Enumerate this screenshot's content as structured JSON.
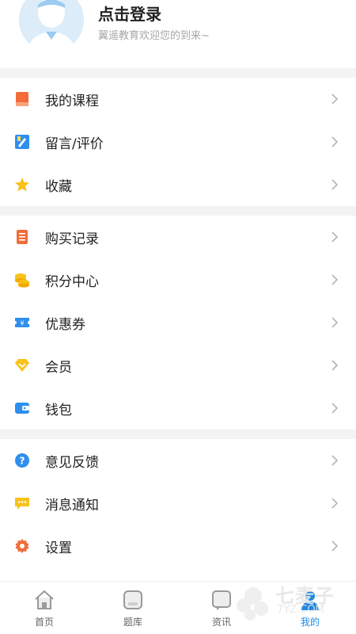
{
  "profile": {
    "title": "点击登录",
    "subtitle": "翼遥教育欢迎您的到来~"
  },
  "menu_groups": [
    [
      {
        "label": "我的课程",
        "icon": "book-icon",
        "color": "#f26b3a"
      },
      {
        "label": "留言/评价",
        "icon": "comment-edit-icon",
        "color": "#2e8ff0"
      },
      {
        "label": "收藏",
        "icon": "star-icon",
        "color": "#f7c21a"
      }
    ],
    [
      {
        "label": "购买记录",
        "icon": "receipt-icon",
        "color": "#f26b3a"
      },
      {
        "label": "积分中心",
        "icon": "coins-icon",
        "color": "#f7c21a"
      },
      {
        "label": "优惠券",
        "icon": "coupon-icon",
        "color": "#2e8ff0"
      },
      {
        "label": "会员",
        "icon": "diamond-icon",
        "color": "#f7c21a"
      },
      {
        "label": "钱包",
        "icon": "wallet-icon",
        "color": "#2e8ff0"
      }
    ],
    [
      {
        "label": "意见反馈",
        "icon": "question-icon",
        "color": "#2e8ff0"
      },
      {
        "label": "消息通知",
        "icon": "message-icon",
        "color": "#f7c21a"
      },
      {
        "label": "设置",
        "icon": "gear-icon",
        "color": "#f26b3a"
      }
    ]
  ],
  "tabs": [
    {
      "label": "首页",
      "icon": "home-icon",
      "active": false
    },
    {
      "label": "题库",
      "icon": "question-bank-icon",
      "active": false
    },
    {
      "label": "资讯",
      "icon": "news-icon",
      "active": false
    },
    {
      "label": "我的",
      "icon": "profile-icon",
      "active": true
    }
  ],
  "watermark": {
    "brand": "七麦子",
    "sub": "7YZ.COM"
  },
  "colors": {
    "accent": "#1e88e5",
    "divider": "#f3f3f3"
  }
}
